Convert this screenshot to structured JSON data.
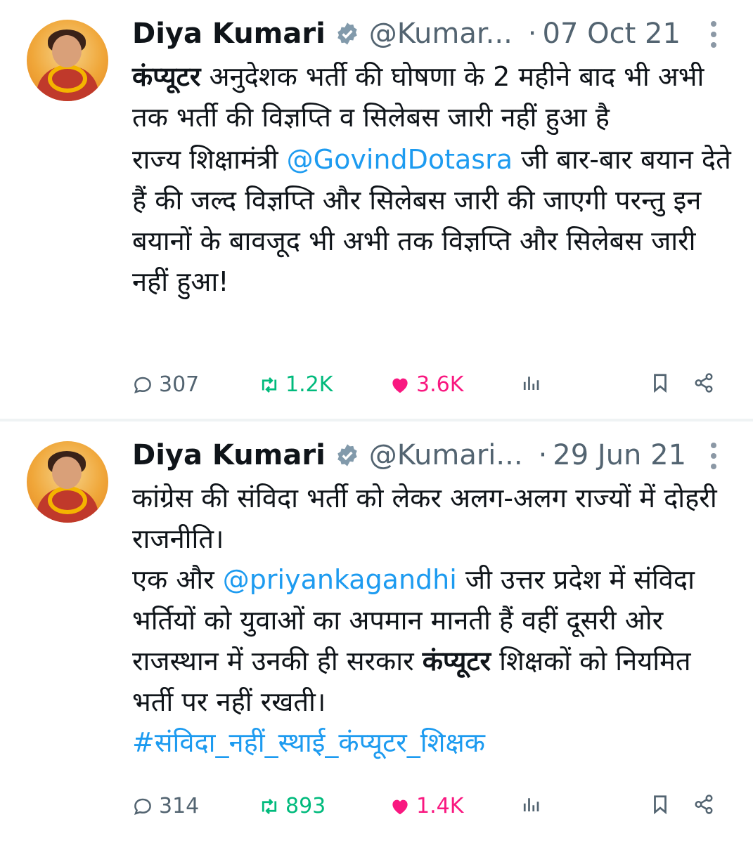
{
  "colors": {
    "link": "#1d9bf0",
    "retweet": "#00ba7c",
    "like": "#f91880",
    "muted": "#536471"
  },
  "tweets": [
    {
      "name": "Diya Kumari",
      "handle": "@Kumar...",
      "date": "07 Oct 21",
      "line1_bold": "कंप्यूटर",
      "line1_rest": " अनुदेशक भर्ती की घोषणा के 2 महीने बाद भी अभी तक भर्ती की विज्ञप्ति व सिलेबस जारी नहीं हुआ है",
      "line2_pre": "राज्य शिक्षामंत्री ",
      "line2_mention": "@GovindDotasra",
      "line2_post": " जी बार-बार बयान देते हैं की जल्द विज्ञप्ति और सिलेबस जारी की जाएगी परन्तु इन बयानों के बावजूद भी अभी तक विज्ञप्ति और सिलेबस जारी नहीं हुआ!",
      "replies": "307",
      "retweets": "1.2K",
      "likes": "3.6K"
    },
    {
      "name": "Diya Kumari",
      "handle": "@Kumari...",
      "date": "29 Jun 21",
      "para1": "कांग्रेस की संविदा भर्ती को लेकर अलग-अलग राज्यों में दोहरी राजनीति।",
      "para2_pre": "एक और ",
      "para2_mention": "@priyankagandhi",
      "para2_mid": " जी उत्तर प्रदेश में संविदा भर्तियों को युवाओं का अपमान मानती हैं वहीं दूसरी ओर राजस्थान में उनकी ही सरकार ",
      "para2_bold": "कंप्यूटर",
      "para2_post": " शिक्षकों को नियमित भर्ती पर नहीं रखती।",
      "hashtag": "#संविदा_नहीं_स्थाई_कंप्यूटर_शिक्षक",
      "replies": "314",
      "retweets": "893",
      "likes": "1.4K"
    }
  ],
  "icons": [
    "reply-icon",
    "retweet-icon",
    "like-icon",
    "views-icon",
    "bookmark-icon",
    "share-icon",
    "verified-icon",
    "more-icon"
  ]
}
